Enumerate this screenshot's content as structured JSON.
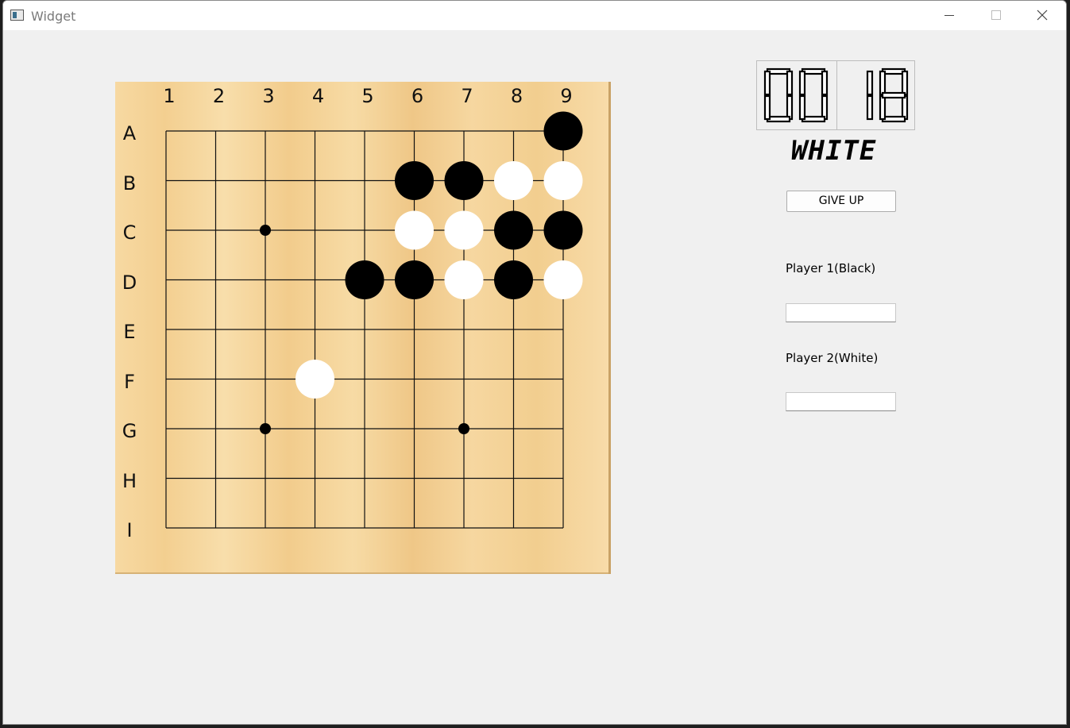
{
  "window": {
    "title": "Widget"
  },
  "board": {
    "size": 9,
    "columns": [
      "1",
      "2",
      "3",
      "4",
      "5",
      "6",
      "7",
      "8",
      "9"
    ],
    "rows": [
      "A",
      "B",
      "C",
      "D",
      "E",
      "F",
      "G",
      "H",
      "I"
    ],
    "star_points": [
      [
        "C",
        3
      ],
      [
        "G",
        3
      ],
      [
        "G",
        7
      ]
    ],
    "stones": [
      {
        "row": "A",
        "col": 9,
        "color": "black"
      },
      {
        "row": "B",
        "col": 6,
        "color": "black"
      },
      {
        "row": "B",
        "col": 7,
        "color": "black"
      },
      {
        "row": "B",
        "col": 8,
        "color": "white"
      },
      {
        "row": "B",
        "col": 9,
        "color": "white"
      },
      {
        "row": "C",
        "col": 6,
        "color": "white"
      },
      {
        "row": "C",
        "col": 7,
        "color": "white"
      },
      {
        "row": "C",
        "col": 8,
        "color": "black"
      },
      {
        "row": "C",
        "col": 9,
        "color": "black"
      },
      {
        "row": "D",
        "col": 5,
        "color": "black"
      },
      {
        "row": "D",
        "col": 6,
        "color": "black"
      },
      {
        "row": "D",
        "col": 7,
        "color": "white"
      },
      {
        "row": "D",
        "col": 8,
        "color": "black"
      },
      {
        "row": "D",
        "col": 9,
        "color": "white"
      },
      {
        "row": "F",
        "col": 4,
        "color": "white"
      }
    ]
  },
  "timer": {
    "minutes": "00",
    "seconds": "18"
  },
  "turn_label": "WHITE",
  "give_up_label": "GIVE UP",
  "player1": {
    "label": "Player 1(Black)",
    "value": ""
  },
  "player2": {
    "label": "Player 2(White)",
    "value": ""
  }
}
